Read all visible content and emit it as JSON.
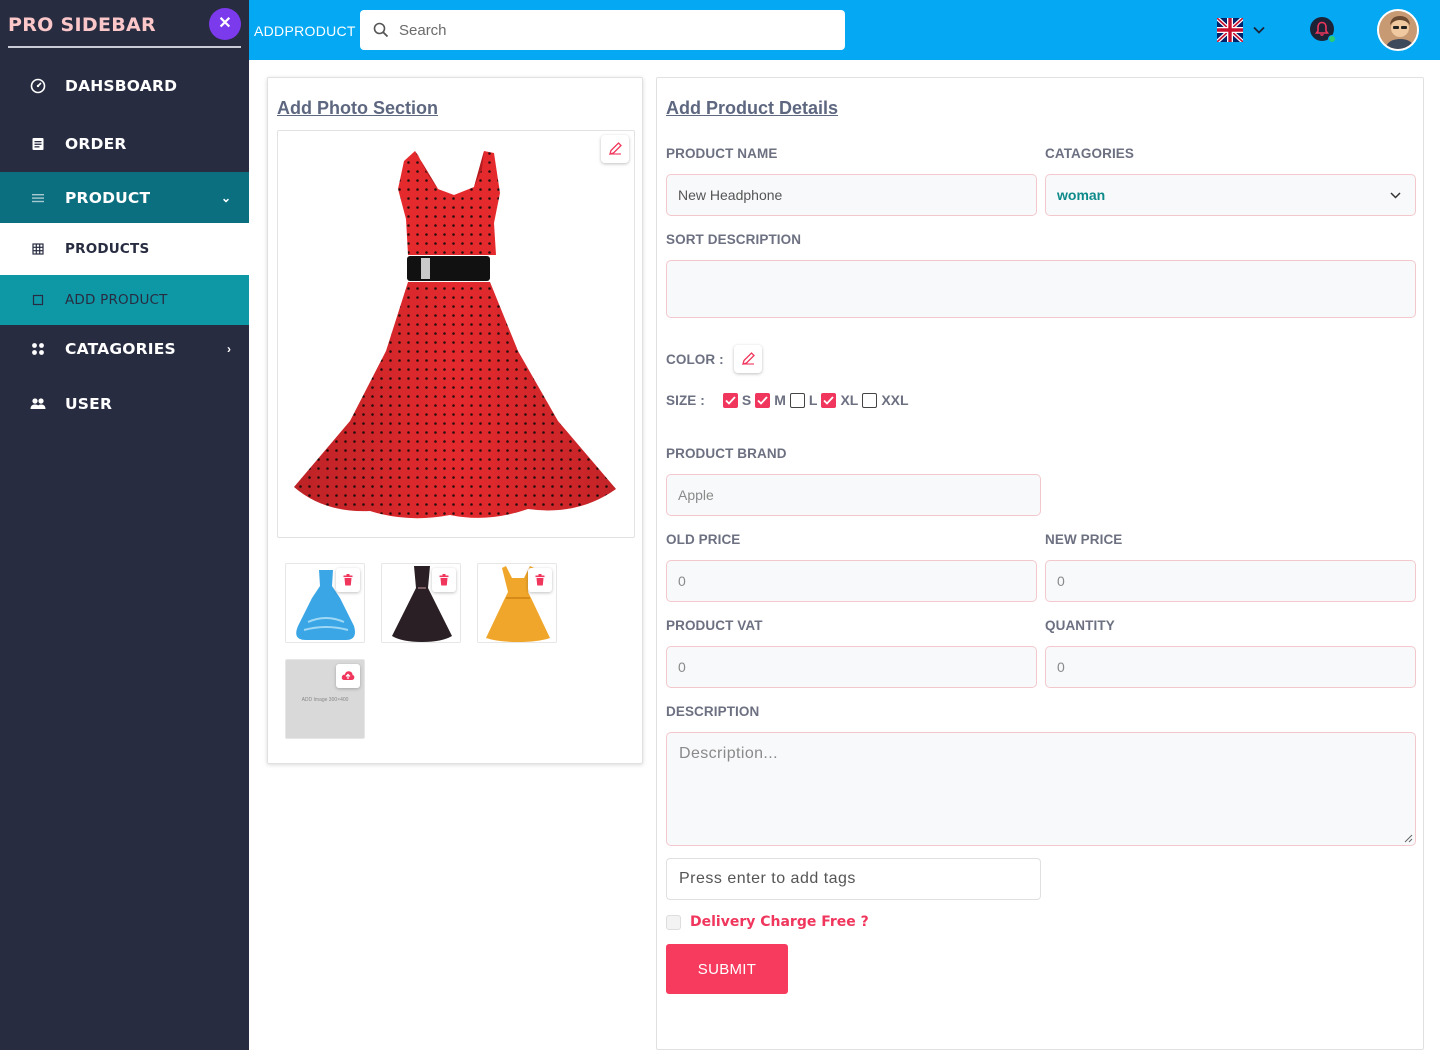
{
  "sidebar": {
    "brand": "PRO SIDEBAR",
    "close_icon_glyph": "✕",
    "items": [
      {
        "label": "DAHSBOARD",
        "icon": "dashboard-gauge-icon"
      },
      {
        "label": "ORDER",
        "icon": "document-icon"
      },
      {
        "label": "PRODUCT",
        "icon": "menu-lines-icon",
        "caret": "⌄"
      },
      {
        "label": "PRODUCTS",
        "icon": "grid-icon"
      },
      {
        "label": "ADD PRODUCT",
        "icon": "square-icon"
      },
      {
        "label": "CATAGORIES",
        "icon": "apps-icon",
        "caret": "›"
      },
      {
        "label": "USER",
        "icon": "users-icon"
      }
    ]
  },
  "header": {
    "page_name": "ADDPRODUCT",
    "search_placeholder": "Search",
    "language_flag": "uk-flag-icon",
    "bell_color": "#f0365c"
  },
  "photo_section": {
    "title": "Add Photo Section",
    "thumbnails": [
      {
        "name": "blue-dress",
        "color": "#3aa6e6"
      },
      {
        "name": "black-dress",
        "color": "#2a1f24"
      },
      {
        "name": "yellow-dress",
        "color": "#f0a62a"
      }
    ],
    "add_image_text": "ADD Image 300×400"
  },
  "details": {
    "title": "Add Product Details",
    "product_name_label": "PRODUCT NAME",
    "product_name_value": "New Headphone",
    "categories_label": "CATAGORIES",
    "categories_value": "woman",
    "sort_description_label": "SORT DESCRIPTION",
    "color_label": "COLOR :",
    "size_label": "SIZE :",
    "sizes": [
      {
        "label": "S",
        "checked": true
      },
      {
        "label": "M",
        "checked": true
      },
      {
        "label": "L",
        "checked": false
      },
      {
        "label": "XL",
        "checked": true
      },
      {
        "label": "XXL",
        "checked": false
      }
    ],
    "brand_label": "PRODUCT BRAND",
    "brand_value": "Apple",
    "old_price_label": "OLD PRICE",
    "old_price_value": "0",
    "new_price_label": "NEW PRICE",
    "new_price_value": "0",
    "vat_label": "PRODUCT VAT",
    "vat_value": "0",
    "quantity_label": "QUANTITY",
    "quantity_value": "0",
    "description_label": "DESCRIPTION",
    "description_placeholder": "Description...",
    "tags_placeholder": "Press enter to add tags",
    "delivery_label": "Delivery Charge Free ?",
    "submit_label": "SUBMIT"
  },
  "colors": {
    "sidebar_bg": "#282c41",
    "header_bg": "#04a8f3",
    "accent": "#f73b5f",
    "active_teal": "#0b6f80"
  }
}
